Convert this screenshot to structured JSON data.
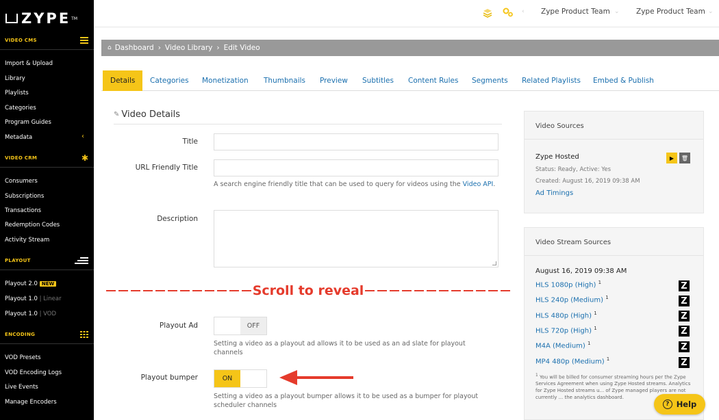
{
  "brand": {
    "logo": "ZYPE",
    "tm": "TM"
  },
  "sidebar": {
    "video_cms": "VIDEO CMS",
    "video_cms_items": [
      "Import & Upload",
      "Library",
      "Playlists",
      "Categories",
      "Program Guides",
      "Metadata"
    ],
    "video_crm": "VIDEO CRM",
    "video_crm_items": [
      "Consumers",
      "Subscriptions",
      "Transactions",
      "Redemption Codes",
      "Activity Stream"
    ],
    "playout": "PLAYOUT",
    "playout_items": [
      {
        "label": "Playout 2.0",
        "badge": "NEW"
      },
      {
        "label": "Playout 1.0",
        "suffix": "| Linear"
      },
      {
        "label": "Playout 1.0",
        "suffix": "| VOD"
      }
    ],
    "encoding": "ENCODING",
    "encoding_items": [
      "VOD Presets",
      "VOD Encoding Logs",
      "Live Events",
      "Manage Encoders"
    ]
  },
  "topbar": {
    "team_1": "Zype Product Team",
    "team_2": "Zype Product Team"
  },
  "breadcrumb": {
    "items": [
      "Dashboard",
      "Video Library",
      "Edit Video"
    ],
    "sep": "›"
  },
  "tabs": [
    "Details",
    "Categories",
    "Monetization",
    "Thumbnails",
    "Preview",
    "Subtitles",
    "Content Rules",
    "Segments",
    "Related Playlists",
    "Embed & Publish"
  ],
  "form": {
    "section_title": "Video Details",
    "title_label": "Title",
    "title_value": "",
    "url_label": "URL Friendly Title",
    "url_value": "",
    "url_help": "A search engine friendly title that can be used to query for videos using the",
    "url_help_link": "Video API",
    "url_help_end": ".",
    "description_label": "Description",
    "scroll_banner": "Scroll to reveal",
    "playout_ad_label": "Playout Ad",
    "playout_ad_state": "OFF",
    "playout_ad_help": "Setting a video as a playout ad allows it to be used as an ad slate for playout channels",
    "playout_bumper_label": "Playout bumper",
    "playout_bumper_state": "ON",
    "playout_bumper_help": "Setting a video as a playout bumper allows it to be used as a bumper for playout scheduler channels"
  },
  "video_sources": {
    "title": "Video Sources",
    "name": "Zype Hosted",
    "status": "Status: Ready, Active: Yes",
    "created": "Created: August 16, 2019 09:38 AM",
    "ad_timings": "Ad Timings"
  },
  "stream_sources": {
    "title": "Video Stream Sources",
    "date": "August 16, 2019 09:38 AM",
    "items": [
      "HLS 1080p (High)",
      "HLS 240p (Medium)",
      "HLS 480p (High)",
      "HLS 720p (High)",
      "M4A (Medium)",
      "MP4 480p (Medium)"
    ],
    "footnote_mark": "1",
    "footnote": "You will be billed for consumer streaming hours per the Zype Services Agreement when using Zype Hosted streams. Analytics for Zype Hosted streams u... of Zype managed players are not currently ... the analytics dashboard."
  },
  "help_button": "Help",
  "colors": {
    "accent": "#f5c518",
    "link": "#1a6fae",
    "annotation": "#e53b2c"
  }
}
